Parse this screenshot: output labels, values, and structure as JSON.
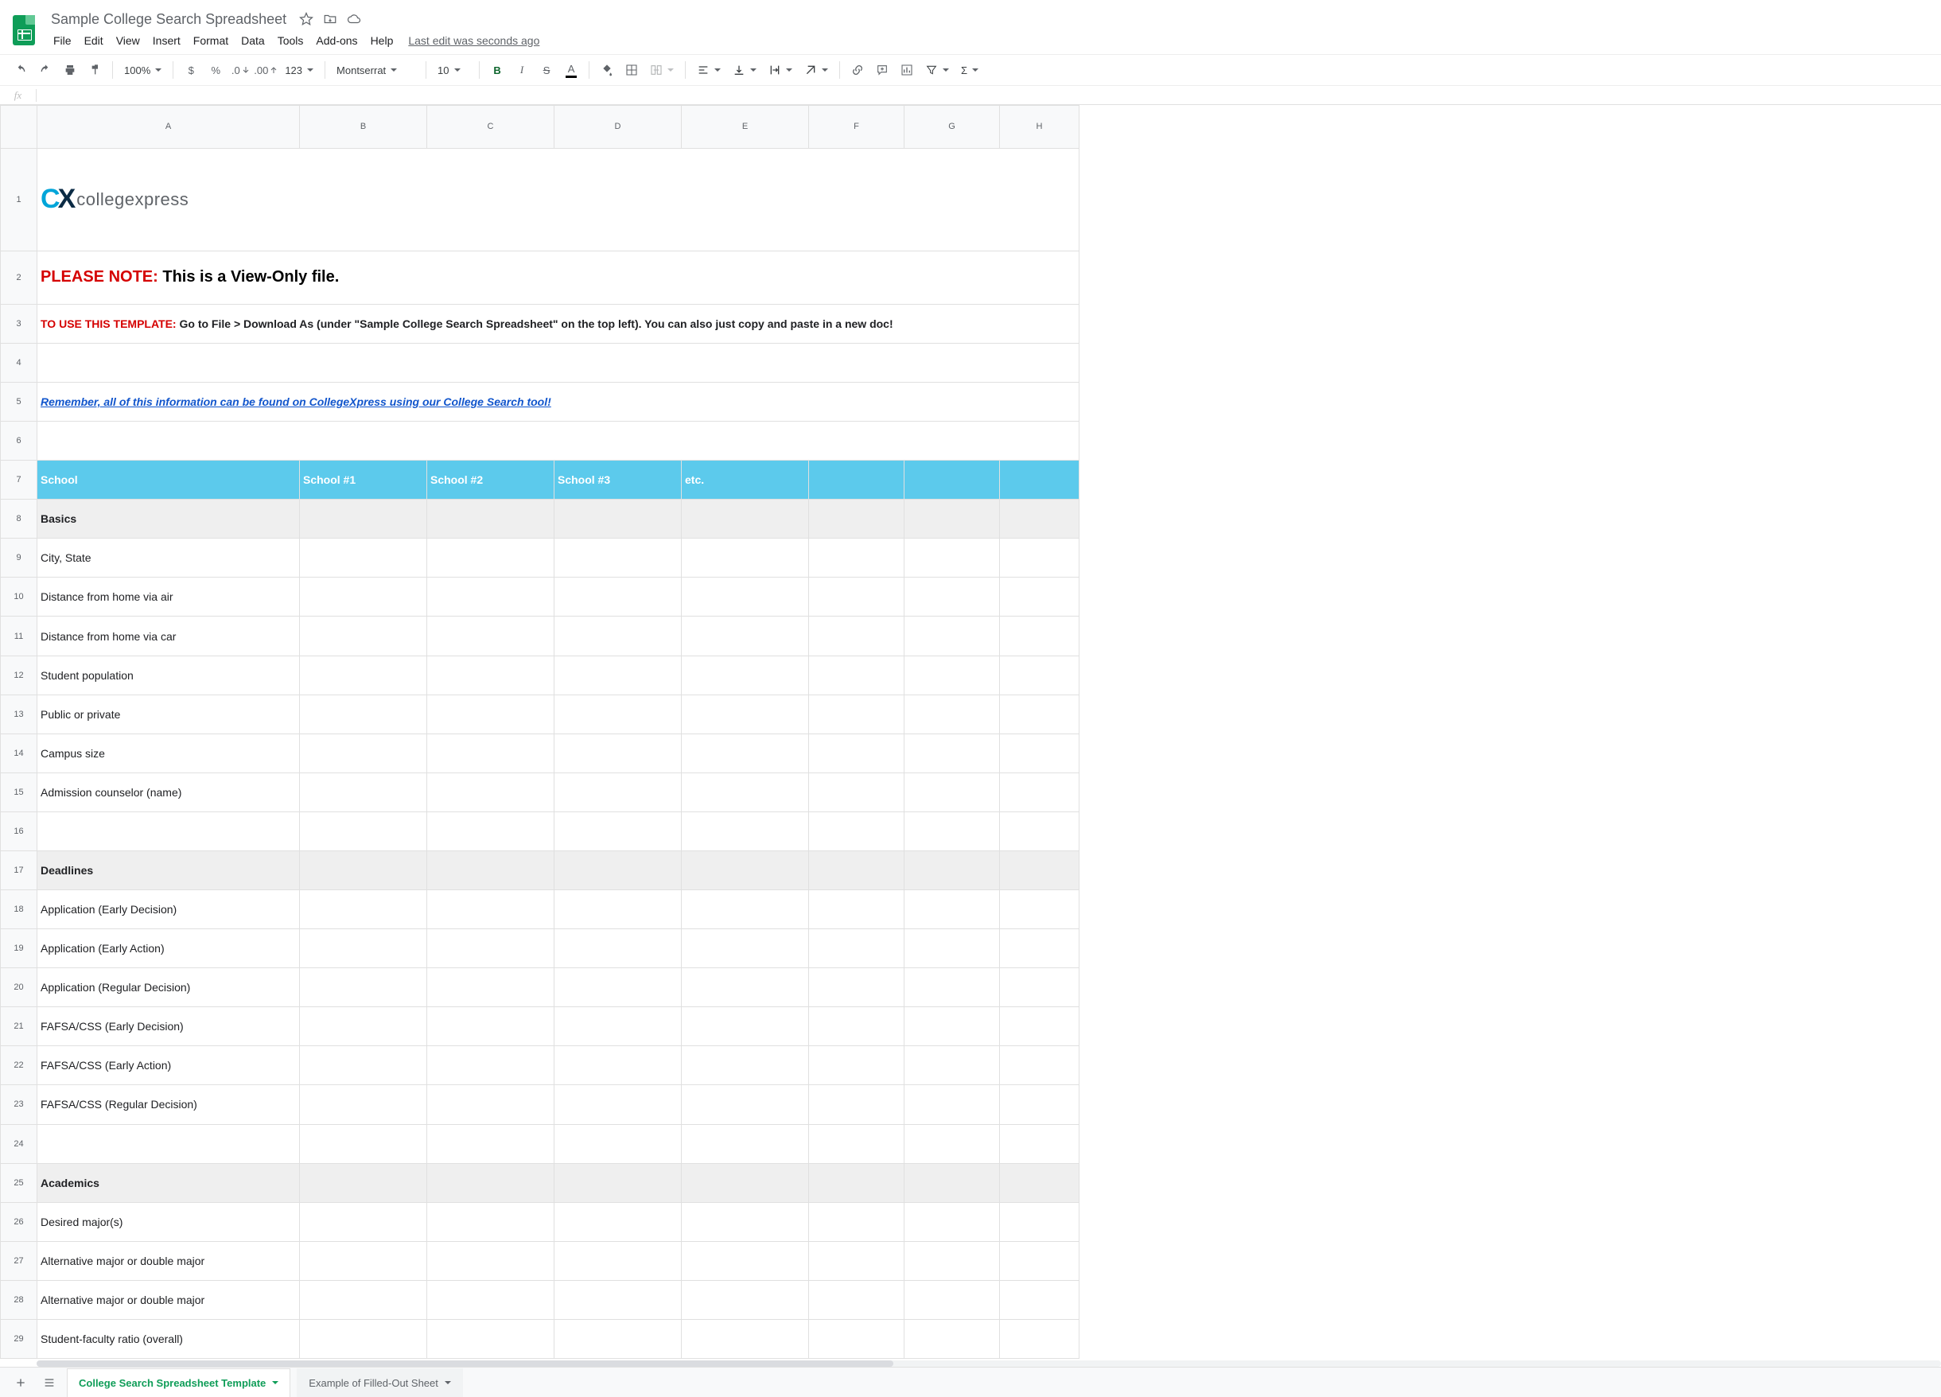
{
  "doc": {
    "title": "Sample College Search Spreadsheet"
  },
  "menu": {
    "file": "File",
    "edit": "Edit",
    "view": "View",
    "insert": "Insert",
    "format": "Format",
    "data": "Data",
    "tools": "Tools",
    "addons": "Add-ons",
    "help": "Help",
    "last_edit": "Last edit was seconds ago"
  },
  "toolbar": {
    "zoom": "100%",
    "font": "Montserrat",
    "font_size": "10",
    "decimal_less": ".0",
    "decimal_more": ".00",
    "num_fmt": "123",
    "currency": "$",
    "percent": "%",
    "bold": "B",
    "italic": "I",
    "strike": "S",
    "color": "A",
    "sigma": "Σ"
  },
  "columns": [
    "A",
    "B",
    "C",
    "D",
    "E",
    "F",
    "G",
    "H"
  ],
  "logo_text": "collegexpress",
  "note": {
    "prefix": "PLEASE NOTE: ",
    "body": "This is a View-Only file.",
    "use_prefix": "TO USE THIS TEMPLATE: ",
    "use_body": "Go to File > Download As (under \"Sample College Search Spreadsheet\" on the top left). You can also just copy and paste in a new doc!",
    "link": "Remember, all of this information can be found on CollegeXpress using our College Search tool!"
  },
  "headers": {
    "a": "School",
    "b": "School #1",
    "c": "School #2",
    "d": "School #3",
    "e": "etc."
  },
  "rows": [
    {
      "n": 8,
      "a": "Basics",
      "section": true
    },
    {
      "n": 9,
      "a": "City, State"
    },
    {
      "n": 10,
      "a": "Distance from home via air"
    },
    {
      "n": 11,
      "a": "Distance from home via car"
    },
    {
      "n": 12,
      "a": "Student population"
    },
    {
      "n": 13,
      "a": "Public or private"
    },
    {
      "n": 14,
      "a": "Campus size"
    },
    {
      "n": 15,
      "a": "Admission counselor (name)"
    },
    {
      "n": 16,
      "a": ""
    },
    {
      "n": 17,
      "a": "Deadlines",
      "section": true
    },
    {
      "n": 18,
      "a": "Application (Early Decision)"
    },
    {
      "n": 19,
      "a": "Application (Early Action)"
    },
    {
      "n": 20,
      "a": "Application (Regular Decision)"
    },
    {
      "n": 21,
      "a": "FAFSA/CSS (Early Decision)"
    },
    {
      "n": 22,
      "a": "FAFSA/CSS (Early Action)"
    },
    {
      "n": 23,
      "a": "FAFSA/CSS (Regular Decision)"
    },
    {
      "n": 24,
      "a": ""
    },
    {
      "n": 25,
      "a": "Academics",
      "section": true
    },
    {
      "n": 26,
      "a": "Desired major(s)"
    },
    {
      "n": 27,
      "a": "Alternative major or double major"
    },
    {
      "n": 28,
      "a": "Alternative major or double major"
    },
    {
      "n": 29,
      "a": "Student-faculty ratio (overall)"
    }
  ],
  "tabs": {
    "active": "College Search Spreadsheet Template",
    "other": "Example of Filled-Out Sheet"
  }
}
